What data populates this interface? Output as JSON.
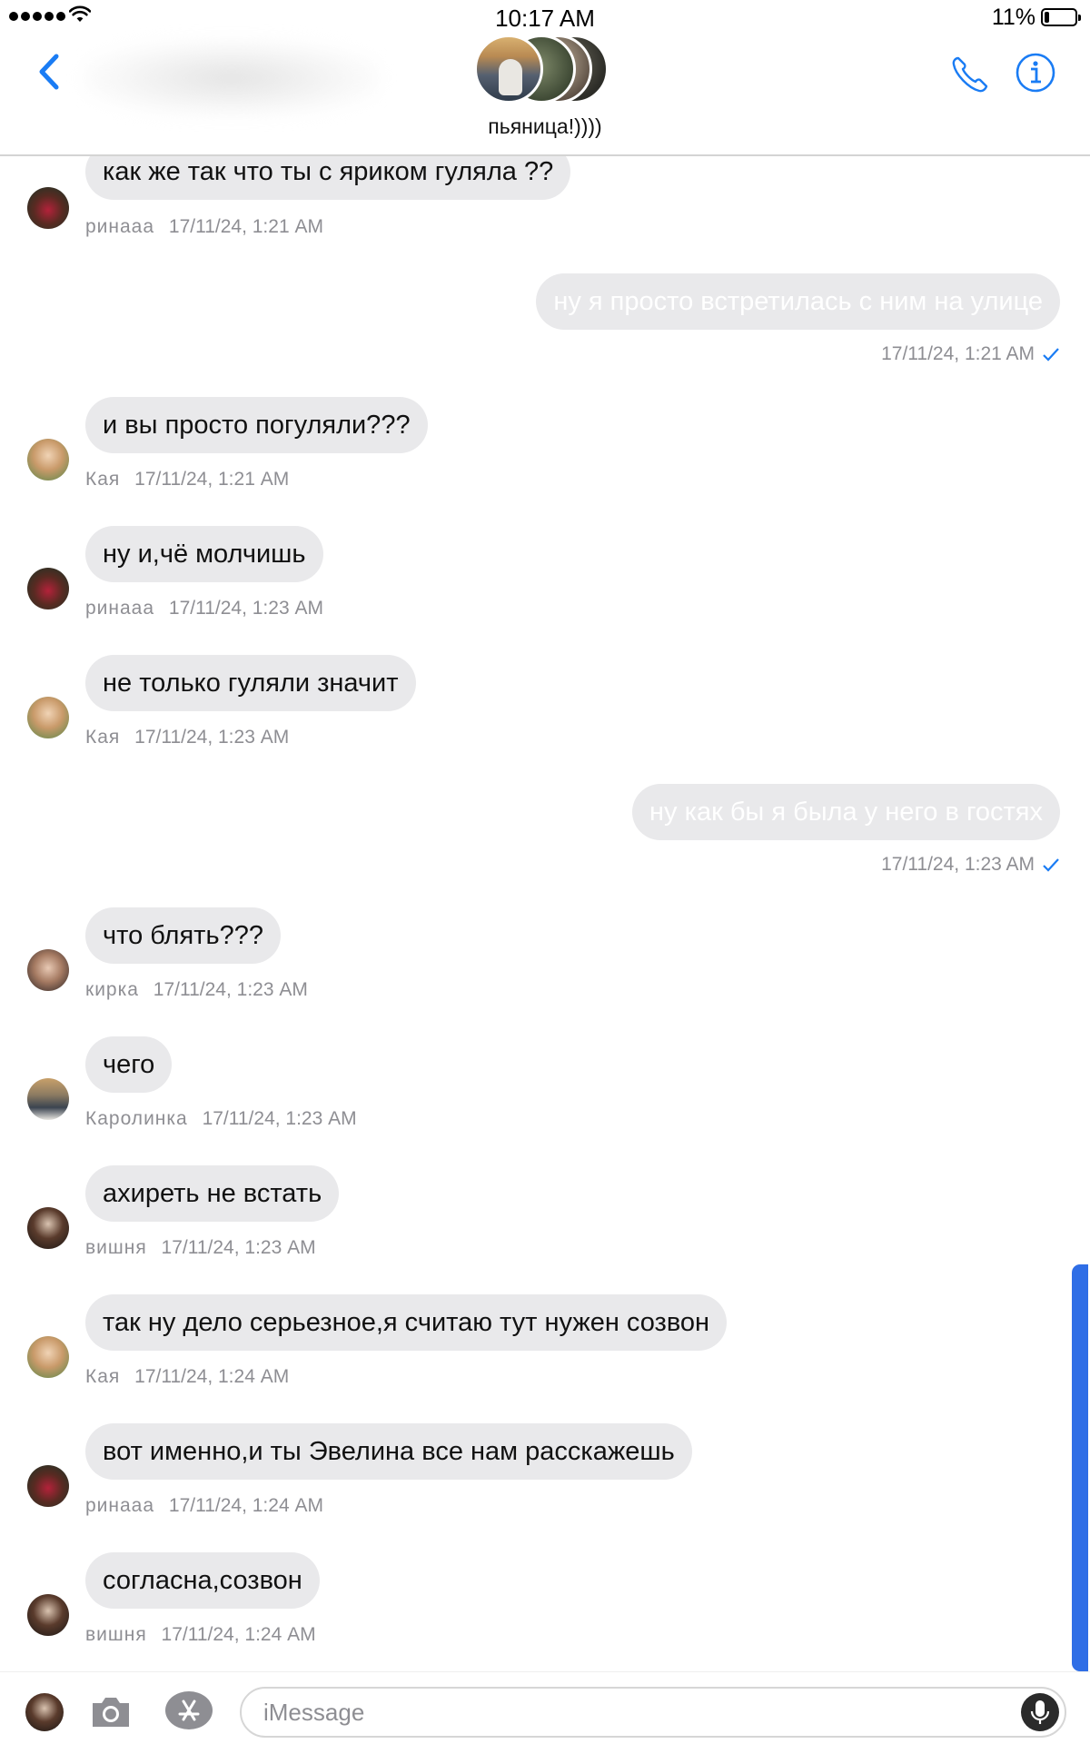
{
  "status_bar": {
    "time": "10:17 AM",
    "battery_percent": "11%",
    "battery_level": 0.11,
    "signal_dots": 5,
    "icons": [
      "signal-dots-icon",
      "wifi-icon",
      "battery-icon"
    ]
  },
  "header": {
    "group_name": "пьяница!))))",
    "icons": [
      "back-chevron-icon",
      "phone-icon",
      "info-icon"
    ],
    "accent_color": "#1a7cf4"
  },
  "messages": [
    {
      "direction": "in",
      "text": "как же так что ты с яриком гуляла ??",
      "sender": "ринааа",
      "time": "17/11/24, 1:21 AM",
      "avatar": "rinaaa"
    },
    {
      "direction": "out",
      "text": "ну я просто встретилась с ним на улице",
      "time": "17/11/24, 1:21 AM",
      "delivered": true
    },
    {
      "direction": "in",
      "text": "и вы просто погуляли???",
      "sender": "Кая",
      "time": "17/11/24, 1:21 AM",
      "avatar": "kaya"
    },
    {
      "direction": "in",
      "text": "ну и,чё молчишь",
      "sender": "ринааа",
      "time": "17/11/24, 1:23 AM",
      "avatar": "rinaaa"
    },
    {
      "direction": "in",
      "text": "не только гуляли значит",
      "sender": "Кая",
      "time": "17/11/24, 1:23 AM",
      "avatar": "kaya"
    },
    {
      "direction": "out",
      "text": "ну как бы я была у него в гостях",
      "time": "17/11/24, 1:23 AM",
      "delivered": true
    },
    {
      "direction": "in",
      "text": "что блять???",
      "sender": "кирка",
      "time": "17/11/24, 1:23 AM",
      "avatar": "kirka"
    },
    {
      "direction": "in",
      "text": "чего",
      "sender": "Каролинка",
      "time": "17/11/24, 1:23 AM",
      "avatar": "karolinka"
    },
    {
      "direction": "in",
      "text": "ахиреть не встать",
      "sender": "вишня",
      "time": "17/11/24, 1:23 AM",
      "avatar": "vishnya"
    },
    {
      "direction": "in",
      "text": "так ну дело серьезное,я считаю тут нужен созвон",
      "sender": "Кая",
      "time": "17/11/24, 1:24 AM",
      "avatar": "kaya"
    },
    {
      "direction": "in",
      "text": "вот именно,и ты Эвелина все нам расскажешь",
      "sender": "ринааа",
      "time": "17/11/24, 1:24 AM",
      "avatar": "rinaaa"
    },
    {
      "direction": "in",
      "text": "согласна,созвон",
      "sender": "вишня",
      "time": "17/11/24, 1:24 AM",
      "avatar": "vishnya"
    }
  ],
  "input_bar": {
    "placeholder": "iMessage",
    "icons": [
      "camera-icon",
      "app-store-icon",
      "microphone-icon"
    ]
  },
  "colors": {
    "bubble_incoming": "#e9e9eb",
    "bubble_outgoing": "#e9e9eb",
    "meta_text": "#8e8e93",
    "check": "#1a7cf4",
    "scroll_indicator": "#2f6ee6"
  }
}
